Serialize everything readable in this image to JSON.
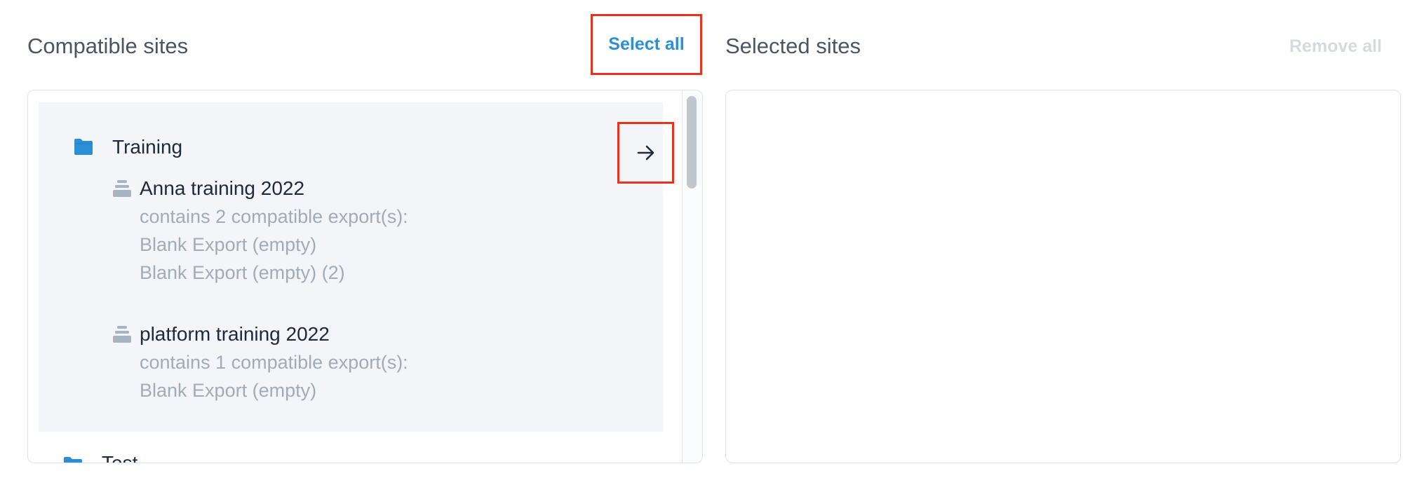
{
  "left_panel": {
    "title": "Compatible sites",
    "select_all_label": "Select all",
    "folders": [
      {
        "name": "Training",
        "icon": "folder-icon",
        "sites": [
          {
            "name": "Anna training 2022",
            "icon": "database-icon",
            "summary": "contains 2 compatible export(s):",
            "exports": [
              "Blank Export (empty)",
              "Blank Export (empty) (2)"
            ]
          },
          {
            "name": "platform training 2022",
            "icon": "database-icon",
            "summary": "contains 1 compatible export(s):",
            "exports": [
              "Blank Export (empty)"
            ]
          }
        ]
      },
      {
        "name": "Test",
        "icon": "folder-icon"
      }
    ]
  },
  "right_panel": {
    "title": "Selected sites",
    "remove_all_label": "Remove all"
  },
  "colors": {
    "accent": "#2b8fd6",
    "highlight_border": "#e8321d",
    "muted_text": "#a3abb5",
    "group_background": "#f3f5f8"
  }
}
